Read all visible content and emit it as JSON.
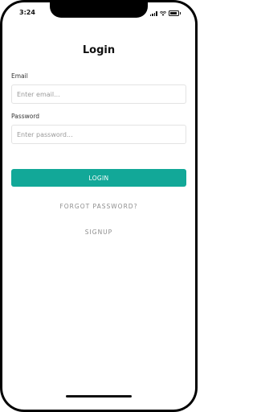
{
  "status_bar": {
    "time": "3:24",
    "icons": [
      "signal-icon",
      "wifi-icon",
      "battery-icon"
    ]
  },
  "login_form": {
    "title": "Login",
    "email_label": "Email",
    "email_placeholder": "Enter email...",
    "email_value": "",
    "password_label": "Password",
    "password_placeholder": "Enter password...",
    "password_value": "",
    "login_button_label": "LOGIN",
    "forgot_password_label": "FORGOT PASSWORD?",
    "signup_label": "SIGNUP"
  },
  "colors": {
    "accent": "#12a898",
    "frame": "#000000",
    "background": "#ffffff",
    "muted_text": "#8d8d8d"
  }
}
